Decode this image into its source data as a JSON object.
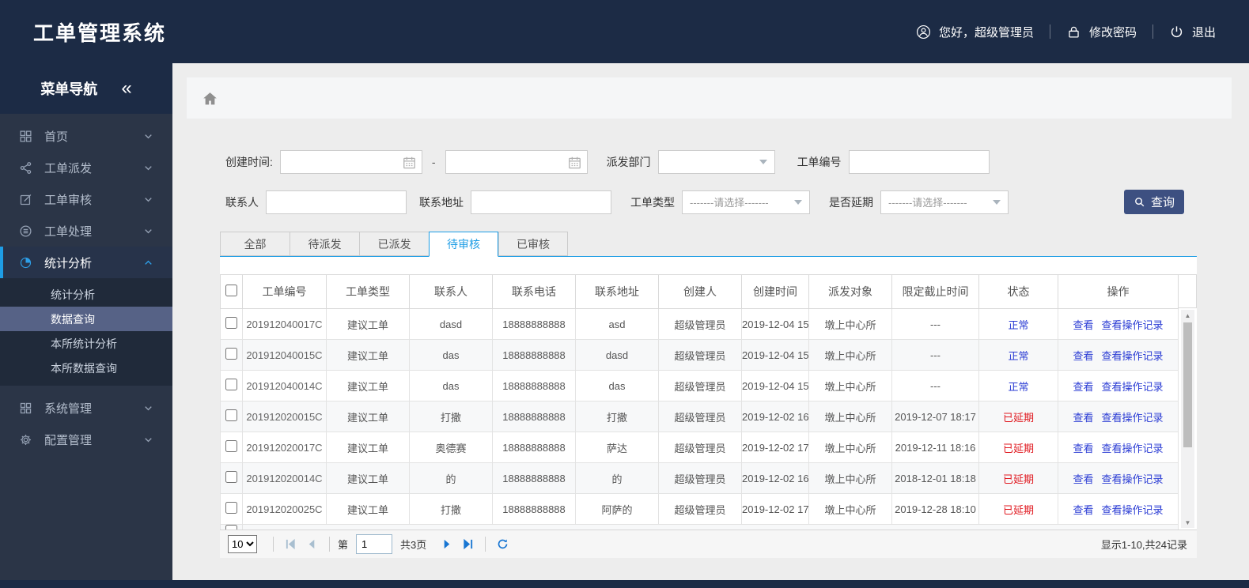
{
  "colors": {
    "topbar_bg": "#1c2b45",
    "sidebar_bg": "#2b3547",
    "submenu_bg": "#202a3a",
    "submenu_selected_bg": "#566286",
    "accent_blue": "#1e9de5",
    "link_blue": "#2b3cd4",
    "status_normal": "#2b3cd4",
    "status_delayed": "#e0181f",
    "search_button_bg": "#3d5081"
  },
  "icons": {
    "topbar": [
      "user-icon",
      "lock-icon",
      "power-icon"
    ],
    "sidebar": [
      "grid-icon",
      "share-icon",
      "edit-icon",
      "process-icon",
      "pie-chart-icon",
      "modules-icon",
      "gear-icon",
      "collapse-icon",
      "chevron-down-icon",
      "chevron-up-icon"
    ],
    "breadcrumb": [
      "home-icon"
    ],
    "filters": [
      "calendar-icon",
      "select-caret-icon",
      "search-icon"
    ],
    "pager": [
      "first-page-icon",
      "prev-page-icon",
      "next-page-icon",
      "last-page-icon",
      "refresh-icon"
    ],
    "scrollbar": [
      "up-arrow-icon",
      "down-arrow-icon"
    ]
  },
  "header": {
    "app_title": "工单管理系统",
    "greeting": "您好，超级管理员",
    "change_password": "修改密码",
    "logout": "退出"
  },
  "sidebar": {
    "nav_title": "菜单导航",
    "collapse_glyph": "«",
    "items": [
      {
        "label": "首页"
      },
      {
        "label": "工单派发"
      },
      {
        "label": "工单审核"
      },
      {
        "label": "工单处理"
      },
      {
        "label": "统计分析",
        "expanded": true,
        "children": [
          {
            "label": "统计分析"
          },
          {
            "label": "数据查询",
            "selected": true
          },
          {
            "label": "本所统计分析"
          },
          {
            "label": "本所数据查询"
          }
        ]
      },
      {
        "label": "系统管理"
      },
      {
        "label": "配置管理"
      }
    ]
  },
  "filters": {
    "create_time": {
      "label": "创建时间:",
      "start_value": "",
      "end_value": "",
      "separator": "-"
    },
    "dispatch_dept": {
      "label": "派发部门",
      "value": ""
    },
    "order_no": {
      "label": "工单编号",
      "value": ""
    },
    "contact": {
      "label": "联系人",
      "value": ""
    },
    "address": {
      "label": "联系地址",
      "value": ""
    },
    "order_type": {
      "label": "工单类型",
      "value": "-------请选择-------"
    },
    "is_delayed": {
      "label": "是否延期",
      "value": "-------请选择-------"
    },
    "search_button": "查询"
  },
  "tabs": [
    {
      "label": "全部"
    },
    {
      "label": "待派发"
    },
    {
      "label": "已派发"
    },
    {
      "label": "待审核",
      "active": true
    },
    {
      "label": "已审核"
    }
  ],
  "table": {
    "columns": [
      "工单编号",
      "工单类型",
      "联系人",
      "联系电话",
      "联系地址",
      "创建人",
      "创建时间",
      "派发对象",
      "限定截止时间",
      "状态",
      "操作"
    ],
    "action_labels": [
      "查看",
      "查看操作记录"
    ],
    "rows": [
      {
        "no": "201912040017C",
        "type": "建议工单",
        "contact": "dasd",
        "phone": "18888888888",
        "address": "asd",
        "creator": "超级管理员",
        "created": "2019-12-04 15",
        "target": "墩上中心所",
        "deadline": "---",
        "status": "正常",
        "status_type": "normal"
      },
      {
        "no": "201912040015C",
        "type": "建议工单",
        "contact": "das",
        "phone": "18888888888",
        "address": "dasd",
        "creator": "超级管理员",
        "created": "2019-12-04 15",
        "target": "墩上中心所",
        "deadline": "---",
        "status": "正常",
        "status_type": "normal"
      },
      {
        "no": "201912040014C",
        "type": "建议工单",
        "contact": "das",
        "phone": "18888888888",
        "address": "das",
        "creator": "超级管理员",
        "created": "2019-12-04 15",
        "target": "墩上中心所",
        "deadline": "---",
        "status": "正常",
        "status_type": "normal"
      },
      {
        "no": "201912020015C",
        "type": "建议工单",
        "contact": "打撒",
        "phone": "18888888888",
        "address": "打撒",
        "creator": "超级管理员",
        "created": "2019-12-02 16",
        "target": "墩上中心所",
        "deadline": "2019-12-07 18:17",
        "status": "已延期",
        "status_type": "delayed"
      },
      {
        "no": "201912020017C",
        "type": "建议工单",
        "contact": "奥德赛",
        "phone": "18888888888",
        "address": "萨达",
        "creator": "超级管理员",
        "created": "2019-12-02 17",
        "target": "墩上中心所",
        "deadline": "2019-12-11 18:16",
        "status": "已延期",
        "status_type": "delayed"
      },
      {
        "no": "201912020014C",
        "type": "建议工单",
        "contact": "的",
        "phone": "18888888888",
        "address": "的",
        "creator": "超级管理员",
        "created": "2019-12-02 16",
        "target": "墩上中心所",
        "deadline": "2018-12-01 18:18",
        "status": "已延期",
        "status_type": "delayed"
      },
      {
        "no": "201912020025C",
        "type": "建议工单",
        "contact": "打撒",
        "phone": "18888888888",
        "address": "阿萨的",
        "creator": "超级管理员",
        "created": "2019-12-02 17",
        "target": "墩上中心所",
        "deadline": "2019-12-28 18:10",
        "status": "已延期",
        "status_type": "delayed"
      }
    ]
  },
  "pagination": {
    "page_size": "10",
    "page_prefix": "第",
    "page_value": "1",
    "total_pages": "共3页",
    "summary": "显示1-10,共24记录"
  }
}
